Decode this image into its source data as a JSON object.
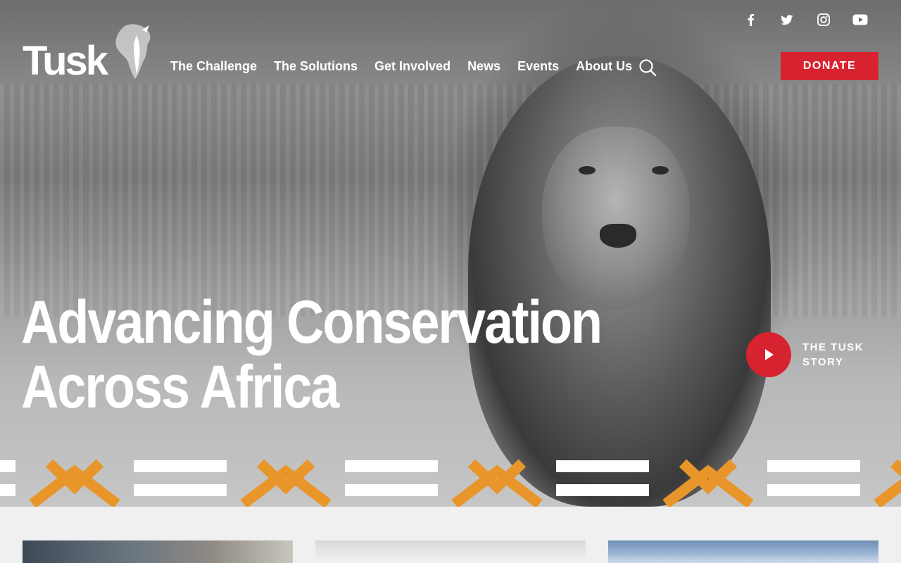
{
  "brand": {
    "name": "Tusk"
  },
  "social": {
    "items": [
      {
        "name": "facebook",
        "icon": "facebook-icon"
      },
      {
        "name": "twitter",
        "icon": "twitter-icon"
      },
      {
        "name": "instagram",
        "icon": "instagram-icon"
      },
      {
        "name": "youtube",
        "icon": "youtube-icon"
      }
    ]
  },
  "nav": {
    "items": [
      {
        "label": "The Challenge"
      },
      {
        "label": "The Solutions"
      },
      {
        "label": "Get Involved"
      },
      {
        "label": "News"
      },
      {
        "label": "Events"
      },
      {
        "label": "About Us"
      }
    ],
    "search_icon": "search-icon",
    "donate_label": "DONATE"
  },
  "hero": {
    "headline_line1": "Advancing Conservation",
    "headline_line2": "Across Africa",
    "story_label": "THE TUSK STORY"
  },
  "colors": {
    "accent_red": "#d7232f",
    "pattern_orange": "#e8962a",
    "text_white": "#ffffff",
    "page_bg": "#f0f0f0"
  }
}
